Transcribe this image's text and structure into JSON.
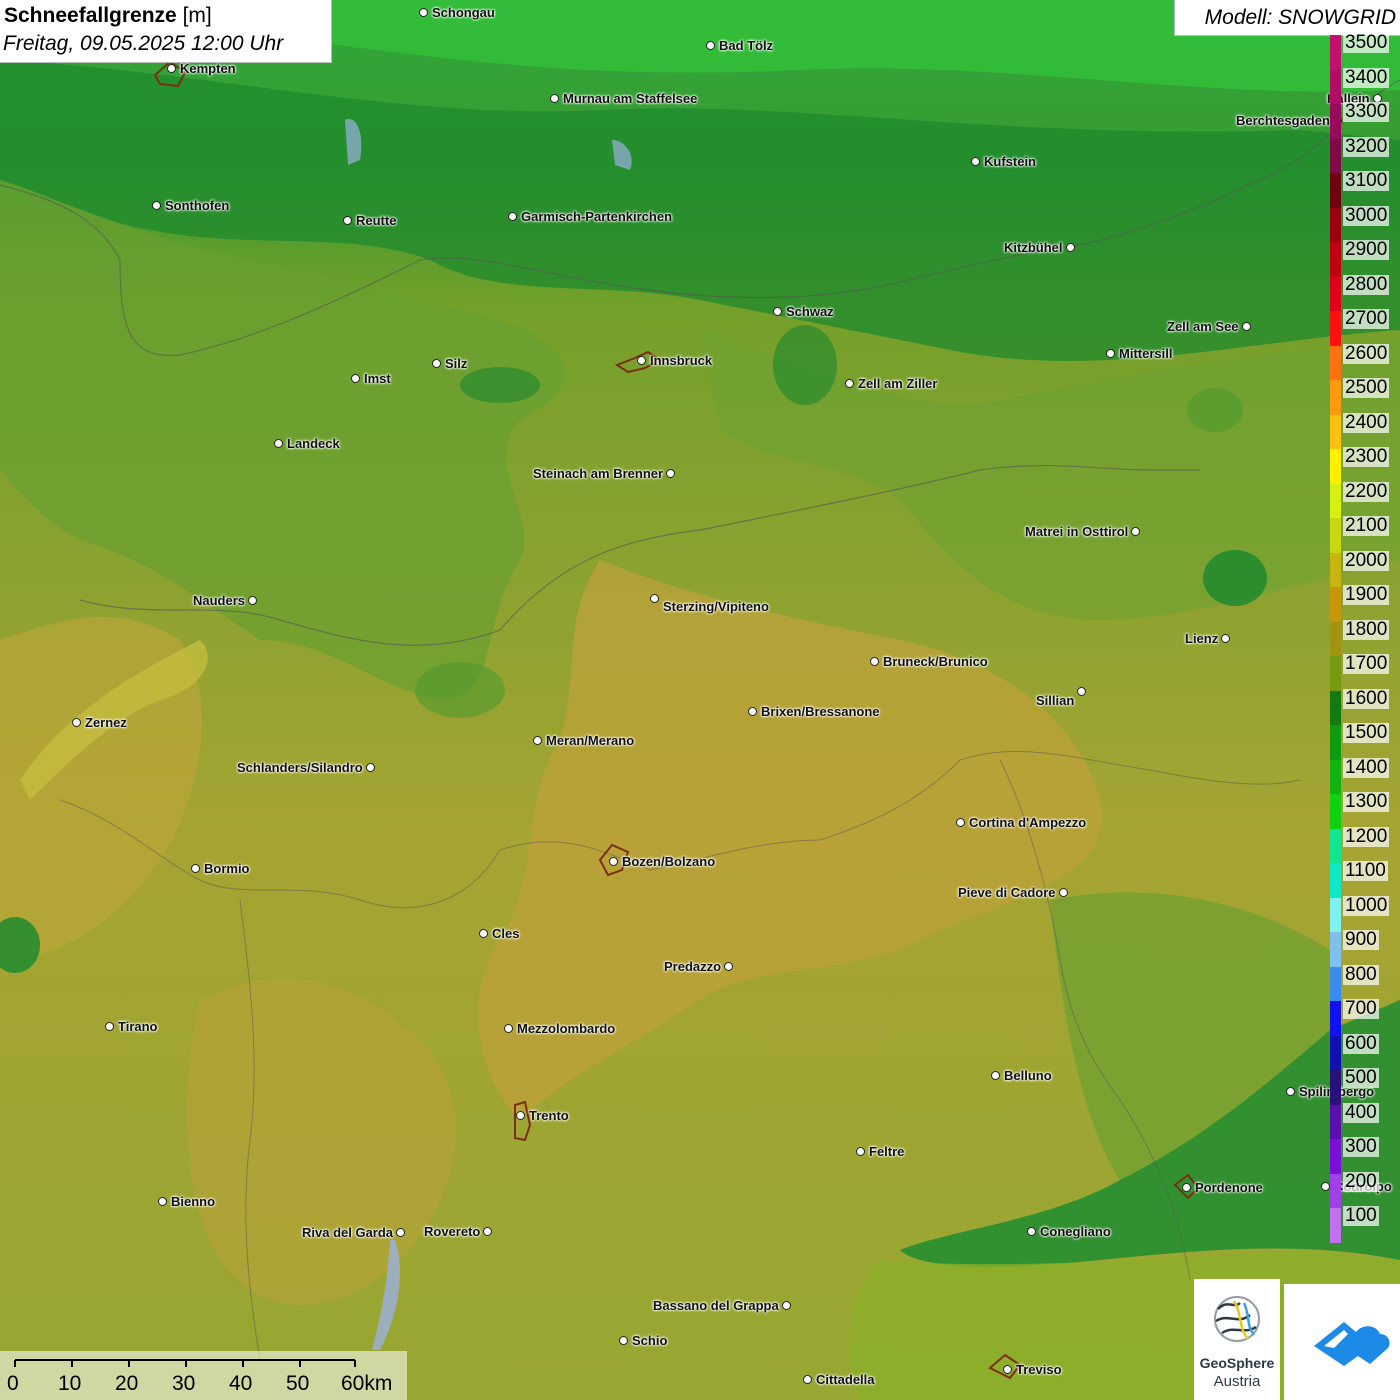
{
  "header": {
    "title_bold": "Schneefallgrenze",
    "title_unit": "[m]",
    "datetime": "Freitag, 09.05.2025 12:00 Uhr",
    "model": "Modell: SNOWGRID"
  },
  "legend": {
    "levels": [
      {
        "label": "3500",
        "color": "#c2106e"
      },
      {
        "label": "3400",
        "color": "#b00d66"
      },
      {
        "label": "3300",
        "color": "#9a0a5c"
      },
      {
        "label": "3200",
        "color": "#820848"
      },
      {
        "label": "3100",
        "color": "#6e0010"
      },
      {
        "label": "3000",
        "color": "#9a0010"
      },
      {
        "label": "2900",
        "color": "#c00010"
      },
      {
        "label": "2800",
        "color": "#e0001a"
      },
      {
        "label": "2700",
        "color": "#ff1010"
      },
      {
        "label": "2600",
        "color": "#ff7010"
      },
      {
        "label": "2500",
        "color": "#ff9a10"
      },
      {
        "label": "2400",
        "color": "#ffc010"
      },
      {
        "label": "2300",
        "color": "#fff000"
      },
      {
        "label": "2200",
        "color": "#d8f010"
      },
      {
        "label": "2100",
        "color": "#c8d810"
      },
      {
        "label": "2000",
        "color": "#c8b410"
      },
      {
        "label": "1900",
        "color": "#c8960a"
      },
      {
        "label": "1800",
        "color": "#a09410"
      },
      {
        "label": "1700",
        "color": "#789a10"
      },
      {
        "label": "1600",
        "color": "#147a14"
      },
      {
        "label": "1500",
        "color": "#109a10"
      },
      {
        "label": "1400",
        "color": "#10b410"
      },
      {
        "label": "1300",
        "color": "#10d010"
      },
      {
        "label": "1200",
        "color": "#10e690"
      },
      {
        "label": "1100",
        "color": "#10e6c8"
      },
      {
        "label": "1000",
        "color": "#80f0f0"
      },
      {
        "label": "900",
        "color": "#80c0f0"
      },
      {
        "label": "800",
        "color": "#3a8af0"
      },
      {
        "label": "700",
        "color": "#1010f0"
      },
      {
        "label": "600",
        "color": "#1010b0"
      },
      {
        "label": "500",
        "color": "#2a107a"
      },
      {
        "label": "400",
        "color": "#5a10b0"
      },
      {
        "label": "300",
        "color": "#7a10d8"
      },
      {
        "label": "200",
        "color": "#a040e8"
      },
      {
        "label": "100",
        "color": "#c070f0"
      }
    ]
  },
  "cities": [
    {
      "name": "Schongau"
    },
    {
      "name": "Bad Tölz"
    },
    {
      "name": "Kempten"
    },
    {
      "name": "Murnau am Staffelsee"
    },
    {
      "name": "Hallein"
    },
    {
      "name": "Berchtesgaden"
    },
    {
      "name": "Kufstein"
    },
    {
      "name": "Sonthofen"
    },
    {
      "name": "Reutte"
    },
    {
      "name": "Garmisch-Partenkirchen"
    },
    {
      "name": "Kitzbühel"
    },
    {
      "name": "Schwaz"
    },
    {
      "name": "Zell am See"
    },
    {
      "name": "Mittersill"
    },
    {
      "name": "Silz"
    },
    {
      "name": "Innsbruck"
    },
    {
      "name": "Imst"
    },
    {
      "name": "Zell am Ziller"
    },
    {
      "name": "Landeck"
    },
    {
      "name": "Steinach am Brenner"
    },
    {
      "name": "Matrei in Osttirol"
    },
    {
      "name": "Nauders"
    },
    {
      "name": "Sterzing/Vipiteno"
    },
    {
      "name": "Lienz"
    },
    {
      "name": "Bruneck/Brunico"
    },
    {
      "name": "Sillian"
    },
    {
      "name": "Zernez"
    },
    {
      "name": "Brixen/Bressanone"
    },
    {
      "name": "Meran/Merano"
    },
    {
      "name": "Schlanders/Silandro"
    },
    {
      "name": "Cortina d'Ampezzo"
    },
    {
      "name": "Bormio"
    },
    {
      "name": "Bozen/Bolzano"
    },
    {
      "name": "Pieve di Cadore"
    },
    {
      "name": "Cles"
    },
    {
      "name": "Predazzo"
    },
    {
      "name": "Tirano"
    },
    {
      "name": "Mezzolombardo"
    },
    {
      "name": "Belluno"
    },
    {
      "name": "Spilimbergo"
    },
    {
      "name": "Trento"
    },
    {
      "name": "Feltre"
    },
    {
      "name": "Pordenone"
    },
    {
      "name": "Codroipo"
    },
    {
      "name": "Bienno"
    },
    {
      "name": "Riva del Garda"
    },
    {
      "name": "Rovereto"
    },
    {
      "name": "Conegliano"
    },
    {
      "name": "Bassano del Grappa"
    },
    {
      "name": "Schio"
    },
    {
      "name": "Treviso"
    },
    {
      "name": "Cittadella"
    }
  ],
  "scalebar": {
    "ticks": [
      "0",
      "10",
      "20",
      "30",
      "40",
      "50",
      "60km"
    ]
  },
  "logos": {
    "geosphere_line1": "GeoSphere",
    "geosphere_line2": "Austria"
  }
}
